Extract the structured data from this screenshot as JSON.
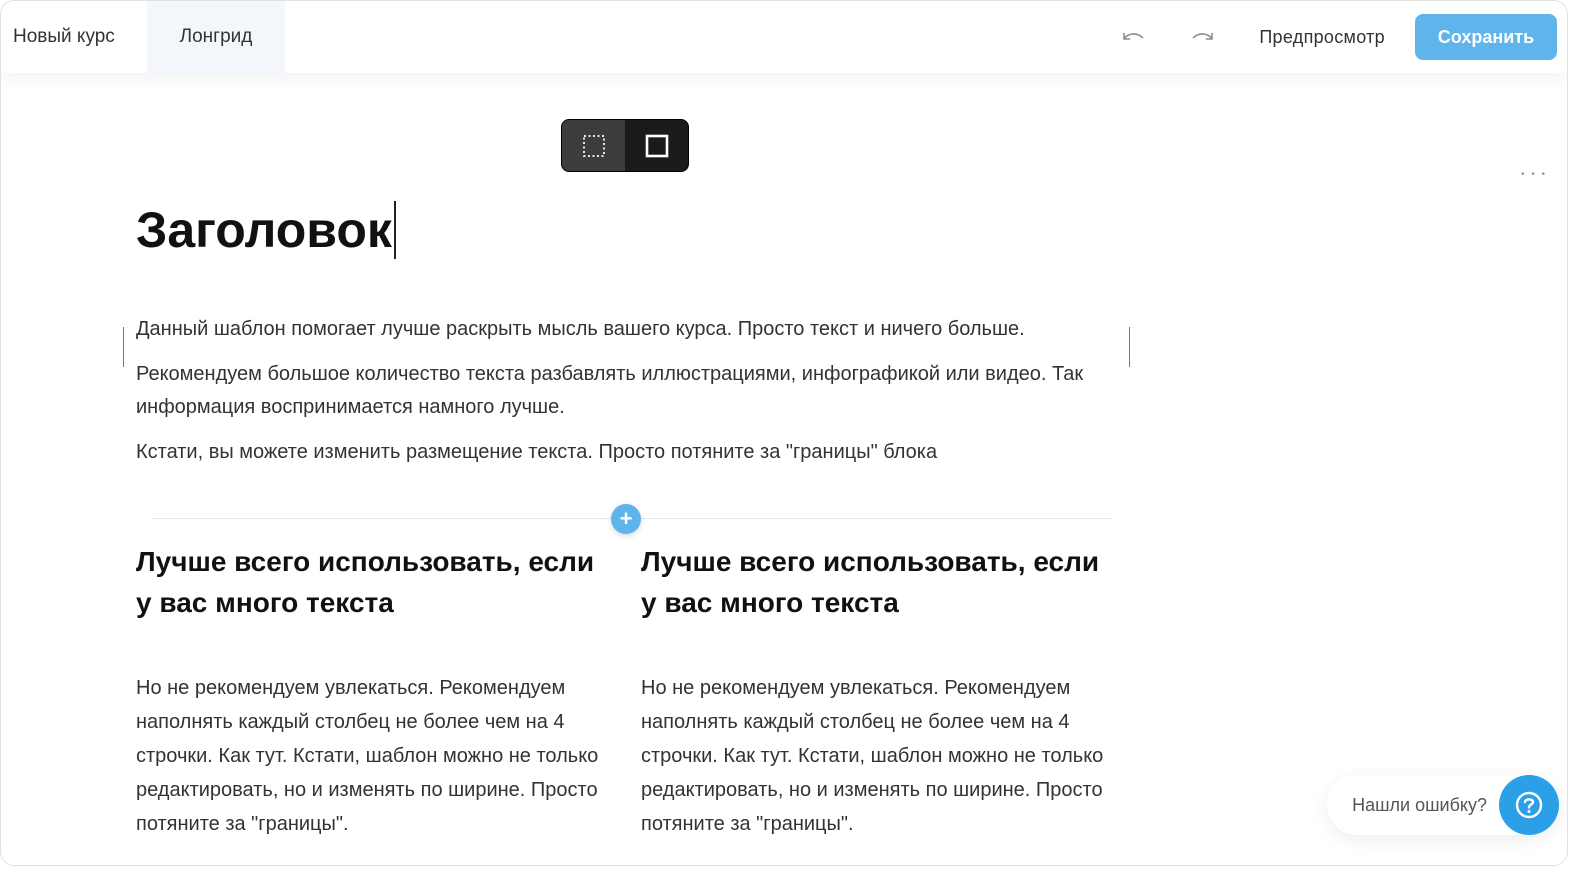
{
  "header": {
    "course_tab": "Новый курс",
    "active_tab": "Лонгрид",
    "preview_label": "Предпросмотр",
    "save_label": "Сохранить"
  },
  "editor": {
    "title": "Заголовок",
    "paragraphs": [
      "Данный шаблон помогает лучше раскрыть мысль вашего курса. Просто текст и ничего больше.",
      "Рекомендуем большое количество текста разбавлять иллюстрациями, инфографикой или видео. Так информация воспринимается намного лучше.",
      "Кстати, вы можете изменить размещение текста. Просто потяните за \"границы\" блока"
    ],
    "columns": [
      {
        "heading": "Лучше всего использовать, если у вас много текста",
        "body": "Но не рекомендуем увлекаться. Рекомендуем наполнять каждый столбец не более чем на 4 строчки. Как тут. Кстати, шаблон можно не только редактировать, но и изменять по ширине. Просто потяните за \"границы\"."
      },
      {
        "heading": "Лучше всего использовать, если у вас много текста",
        "body": "Но не рекомендуем увлекаться. Рекомендуем наполнять каждый столбец не более чем на 4 строчки. Как тут. Кстати, шаблон можно не только редактировать, но и изменять по ширине. Просто потяните за \"границы\"."
      }
    ]
  },
  "help": {
    "label": "Нашли ошибку?"
  },
  "icons": {
    "undo": "undo-icon",
    "redo": "redo-icon",
    "width_toggle_dotted": "dotted-frame-icon",
    "width_toggle_solid": "solid-frame-icon",
    "add": "plus-icon",
    "help": "question-icon"
  },
  "colors": {
    "accent": "#5fb4ec",
    "help_button": "#2b9fe8",
    "toggle_bg": "#1b1b1b"
  }
}
